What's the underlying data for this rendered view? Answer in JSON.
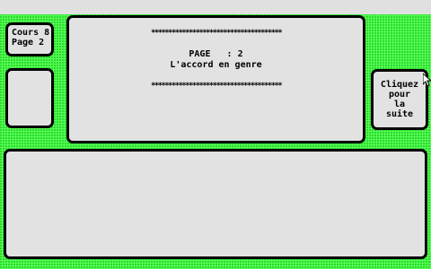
{
  "course": {
    "line1": "Cours 8",
    "line2": "Page 2"
  },
  "main": {
    "stars_top": "**************************************",
    "page_line": "PAGE   : 2",
    "subtitle": "L'accord en genre",
    "stars_bottom": "**************************************"
  },
  "next_button": {
    "line1": "Cliquez",
    "line2": "pour",
    "line3": "la",
    "line4": "suite"
  },
  "colors": {
    "background": "#55ff55",
    "panel": "#e2e2e2",
    "border": "#000000"
  },
  "icons": {
    "cursor": "mouse-pointer-icon"
  }
}
